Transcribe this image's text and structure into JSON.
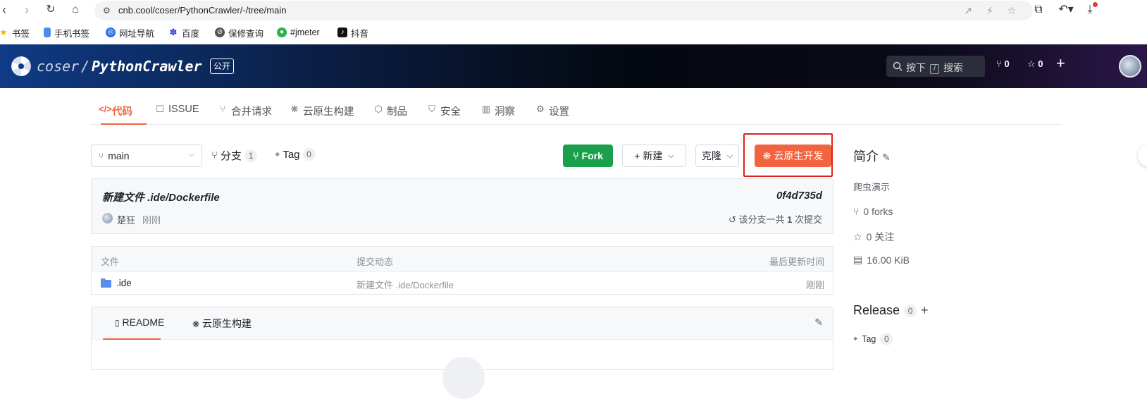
{
  "browser": {
    "url": "cnb.cool/coser/PythonCrawler/-/tree/main",
    "bookmarks": [
      "书签",
      "手机书签",
      "网址导航",
      "百度",
      "保修查询",
      "#jmeter",
      "抖音"
    ]
  },
  "header": {
    "owner": "coser",
    "separator": "/",
    "repo": "PythonCrawler",
    "visibility": "公开",
    "search_prefix": "按下",
    "search_key": "/",
    "search_label": "搜索",
    "fork_count": "0",
    "star_count": "0"
  },
  "tabs": [
    {
      "label": "代码",
      "icon": "code-icon"
    },
    {
      "label": "ISSUE",
      "icon": "issue-icon"
    },
    {
      "label": "合并请求",
      "icon": "merge-icon"
    },
    {
      "label": "云原生构建",
      "icon": "build-icon"
    },
    {
      "label": "制品",
      "icon": "package-icon"
    },
    {
      "label": "安全",
      "icon": "shield-icon"
    },
    {
      "label": "洞察",
      "icon": "insight-icon"
    },
    {
      "label": "设置",
      "icon": "gear-icon"
    }
  ],
  "toolbar": {
    "branch": "main",
    "branches_label": "分支",
    "branches_count": "1",
    "tag_label": "Tag",
    "tag_count": "0",
    "fork_label": "Fork",
    "new_label": "新建",
    "clone_label": "克隆",
    "cloud_dev_label": "云原生开发"
  },
  "commit": {
    "message": "新建文件 .ide/Dockerfile",
    "hash": "0f4d735d",
    "author": "楚狂",
    "time": "刚刚",
    "summary_prefix": "该分支一共",
    "summary_count": "1",
    "summary_suffix": "次提交"
  },
  "files": {
    "headers": [
      "文件",
      "提交动态",
      "最后更新时间"
    ],
    "rows": [
      {
        "name": ".ide",
        "commit": "新建文件 .ide/Dockerfile",
        "time": "刚刚"
      }
    ]
  },
  "readme": {
    "tabs": [
      "README",
      "云原生构建"
    ]
  },
  "sidebar": {
    "intro_title": "简介",
    "description": "爬虫演示",
    "forks": "0 forks",
    "watchers": "0 关注",
    "size": "16.00 KiB",
    "release_title": "Release",
    "release_count": "0",
    "tag_label": "Tag",
    "tag_count": "0"
  },
  "colors": {
    "accent": "#f2643f",
    "fork_green": "#1aa04a",
    "highlight_red": "#e0201f"
  }
}
